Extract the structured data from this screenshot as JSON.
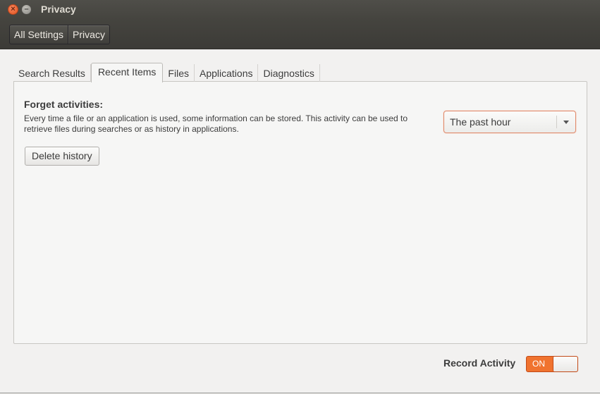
{
  "window": {
    "title": "Privacy"
  },
  "toolbar": {
    "breadcrumb": [
      "All Settings",
      "Privacy"
    ]
  },
  "tabs": [
    "Search Results",
    "Recent Items",
    "Files",
    "Applications",
    "Diagnostics"
  ],
  "active_tab": "Recent Items",
  "forget": {
    "heading": "Forget activities:",
    "description": "Every time a file or an application is used, some information can be stored. This activity can be used to retrieve files during searches or as history in applications.",
    "period_selected": "The past hour",
    "delete_button": "Delete history"
  },
  "footer": {
    "record_label": "Record Activity",
    "toggle_state": "ON"
  },
  "colors": {
    "accent": "#f0732f",
    "titlebar": "#45443f"
  }
}
